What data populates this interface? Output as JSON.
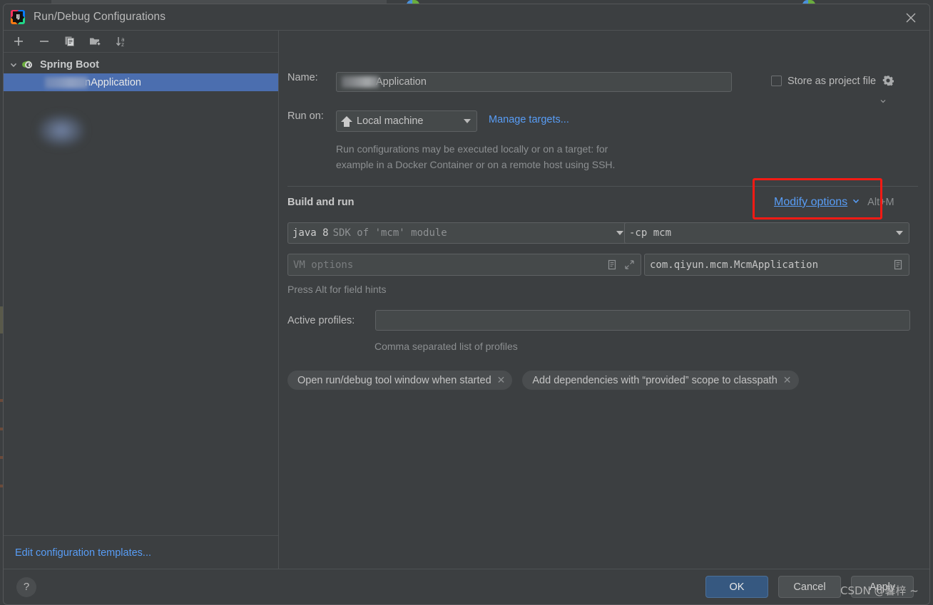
{
  "window": {
    "title": "Run/Debug Configurations",
    "logo_icon": "intellij-idea-logo-icon",
    "close_icon": "close-icon"
  },
  "sidebar": {
    "toolbar": [
      {
        "name": "add-configuration-button",
        "icon": "plus-icon",
        "label": "+"
      },
      {
        "name": "remove-configuration-button",
        "icon": "minus-icon",
        "label": "−"
      },
      {
        "name": "copy-configuration-button",
        "icon": "copy-icon",
        "label": ""
      },
      {
        "name": "new-folder-button",
        "icon": "folder-add-icon",
        "label": ""
      },
      {
        "name": "sort-configurations-button",
        "icon": "sort-az-icon",
        "label": ""
      }
    ],
    "group": {
      "label": "Spring Boot",
      "icon": "spring-boot-icon",
      "expanded_icon": "chevron-down-icon"
    },
    "items": [
      {
        "label": "nApplication",
        "redacted_prefix": true,
        "selected": true
      }
    ],
    "footer_link": "Edit configuration templates..."
  },
  "form": {
    "name_label": "Name:",
    "name_value": "Application",
    "name_redacted_prefix": true,
    "store_as_project_file": {
      "label": "Store as project file",
      "checked": false,
      "gear_icon": "gear-icon"
    },
    "run_on_label": "Run on:",
    "run_on_value": "Local machine",
    "run_on_icon": "home-icon",
    "manage_targets_link": "Manage targets...",
    "description_line1": "Run configurations may be executed locally or on a target: for",
    "description_line2": "example in a Docker Container or on a remote host using SSH.",
    "build_and_run_title": "Build and run",
    "modify_options_link": "Modify options",
    "modify_options_chevron": "chevron-down-icon",
    "modify_options_shortcut": "Alt+M",
    "jdk_value_strong": "java 8",
    "jdk_value_dim": "SDK of 'mcm' module",
    "classpath_value": "-cp mcm",
    "vm_options_placeholder": "VM options",
    "vm_options_macro_icon": "macro-list-icon",
    "vm_options_expand_icon": "expand-icon",
    "main_class_value": "com.qiyun.mcm.McmApplication",
    "main_class_macro_icon": "macro-list-icon",
    "field_hints": "Press Alt for field hints",
    "active_profiles_label": "Active profiles:",
    "active_profiles_value": "",
    "active_profiles_hint": "Comma separated list of profiles",
    "chips": [
      {
        "label": "Open run/debug tool window when started",
        "close_icon": "close-small-icon"
      },
      {
        "label": "Add dependencies with “provided” scope to classpath",
        "close_icon": "close-small-icon"
      }
    ]
  },
  "footer": {
    "help_icon": "help-question-icon",
    "ok_label": "OK",
    "cancel_label": "Cancel",
    "apply_label": "Apply"
  },
  "overlay": {
    "watermark": "CSDN @馨梓 ~",
    "highlight_color": "#f61a14"
  }
}
